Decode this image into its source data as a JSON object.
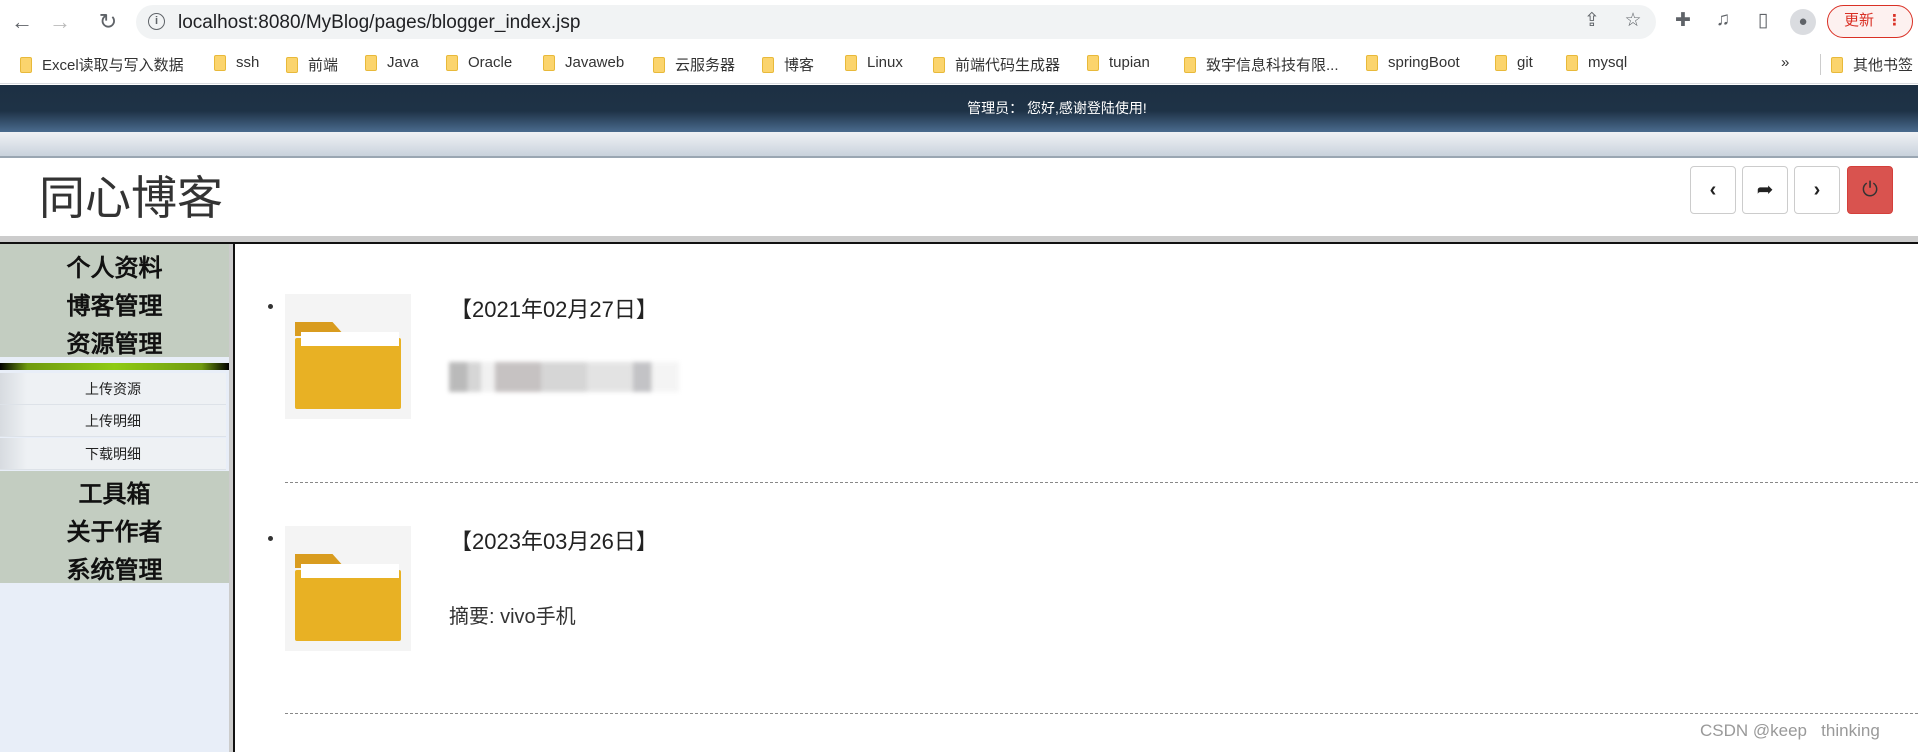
{
  "browser": {
    "url": "localhost:8080/MyBlog/pages/blogger_index.jsp",
    "update_label": "更新",
    "bookmarks": [
      "Excel读取与写入数据",
      "ssh",
      "前端",
      "Java",
      "Oracle",
      "Javaweb",
      "云服务器",
      "博客",
      "Linux",
      "前端代码生成器",
      "tupian",
      "致宇信息科技有限...",
      "springBoot",
      "git",
      "mysql"
    ],
    "overflow": "»",
    "other_bookmarks": "其他书签"
  },
  "banner": {
    "welcome": "管理员：  您好,感谢登陆使用!"
  },
  "header": {
    "title": "同心博客"
  },
  "sidebar": {
    "top_items": [
      "个人资料",
      "博客管理",
      "资源管理"
    ],
    "sub_items": [
      "上传资源",
      "上传明细",
      "下载明细"
    ],
    "bottom_items": [
      "工具箱",
      "关于作者",
      "系统管理"
    ]
  },
  "posts": [
    {
      "date": "【2021年02月27日】",
      "summary": ""
    },
    {
      "date": "【2023年03月26日】",
      "summary": "摘要: vivo手机"
    }
  ],
  "watermark": "CSDN @keep   thinking",
  "colors": {
    "banner": "#1e3246",
    "sidebar_group": "#c3cdc1",
    "logout": "#d9534f",
    "folder": "#e8b124"
  }
}
